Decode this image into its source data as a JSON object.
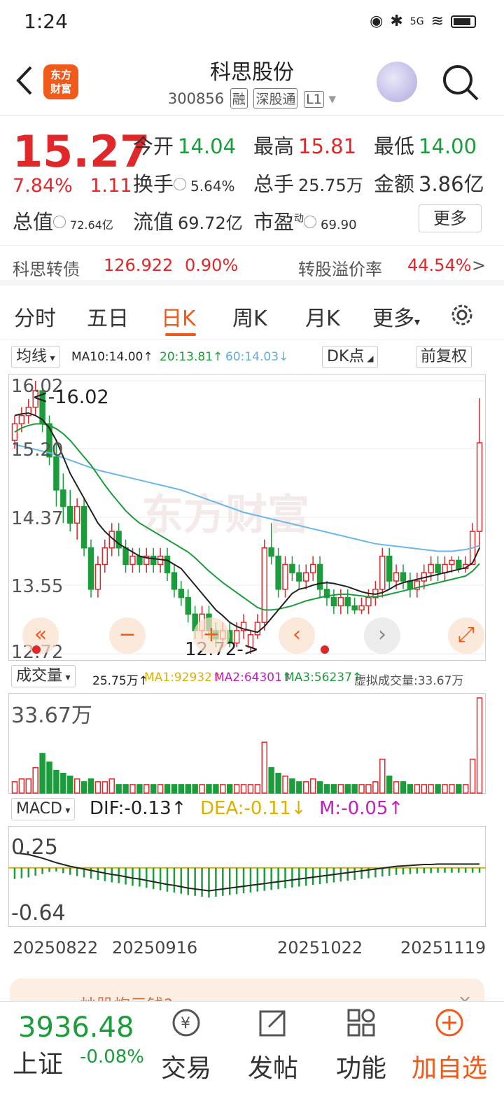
{
  "status": {
    "time": "1:24",
    "network": "5G"
  },
  "header": {
    "logo_text": "东方财富",
    "title": "科思股份",
    "code": "300856",
    "tags": [
      "融",
      "深股通",
      "L1"
    ]
  },
  "quote": {
    "price": "15.27",
    "change_pct": "7.84%",
    "change": "1.11",
    "open_label": "今开",
    "open": "14.04",
    "high_label": "最高",
    "high": "15.81",
    "low_label": "最低",
    "low": "14.00",
    "turnover_label": "换手",
    "turnover": "5.64%",
    "volume_label": "总手",
    "volume": "25.75万",
    "amount_label": "金额",
    "amount": "3.86亿",
    "mktcap_label": "总值",
    "mktcap": "72.64亿",
    "float_label": "流值",
    "float": "69.72亿",
    "pe_label": "市盈",
    "pe_sup": "动",
    "pe": "69.90",
    "more": "更多"
  },
  "bond": {
    "name": "科思转债",
    "price": "126.922",
    "pct": "0.90%",
    "premium_label": "转股溢价率",
    "premium": "44.54%"
  },
  "tabs": [
    "分时",
    "五日",
    "日K",
    "周K",
    "月K",
    "更多"
  ],
  "active_tab": "日K",
  "ma_bar": {
    "selector": "均线",
    "ma10": "MA10:14.00↑",
    "ma20": "20:13.81↑",
    "ma60": "60:14.03↓",
    "dk": "DK点",
    "adjust": "前复权"
  },
  "kline_labels": {
    "y_ticks": [
      "16.02",
      "15.20",
      "14.37",
      "13.55",
      "12.72"
    ],
    "max_label": "<-16.02",
    "min_label": "12.72->",
    "watermark": "东方财富"
  },
  "vol_bar": {
    "selector": "成交量",
    "vol": "25.75万↑",
    "ma1": "MA1:92932↑",
    "ma2": "MA2:64301↑",
    "ma3": "MA3:56237↑",
    "virtual": "虚拟成交量:33.67万",
    "y_max": "33.67万"
  },
  "macd_bar": {
    "selector": "MACD",
    "dif": "DIF:-0.13↑",
    "dea": "DEA:-0.11↓",
    "m": "M:-0.05↑",
    "y_top": "0.25",
    "y_bottom": "-0.64"
  },
  "dates": [
    "20250822",
    "20250916",
    "20251022",
    "20251119"
  ],
  "banner": {
    "text": "炒股炮元钱?"
  },
  "bottom": {
    "index_value": "3936.48",
    "index_name": "上证",
    "index_change": "-0.08%",
    "buttons": [
      "交易",
      "发帖",
      "功能",
      "加自选"
    ]
  },
  "colors": {
    "up": "#e0282a",
    "down": "#1a9d3a",
    "accent": "#f05a1a",
    "ma10": "#222222",
    "ma20": "#1a9d3a",
    "ma60": "#6ab7e8"
  },
  "chart_data": {
    "type": "candlestick",
    "ylim": [
      12.72,
      16.02
    ],
    "candles": [
      [
        15.3,
        15.6,
        15.2,
        15.5
      ],
      [
        15.5,
        15.7,
        15.4,
        15.6
      ],
      [
        15.6,
        15.8,
        15.5,
        15.7
      ],
      [
        15.7,
        16.02,
        15.6,
        15.9
      ],
      [
        15.9,
        16.0,
        15.4,
        15.5
      ],
      [
        15.5,
        15.6,
        15.0,
        15.1
      ],
      [
        15.1,
        15.3,
        14.5,
        14.7
      ],
      [
        14.7,
        14.9,
        14.3,
        14.5
      ],
      [
        14.5,
        14.7,
        14.2,
        14.3
      ],
      [
        14.3,
        14.6,
        14.1,
        14.5
      ],
      [
        14.5,
        14.6,
        13.9,
        14.0
      ],
      [
        14.0,
        14.1,
        13.4,
        13.5
      ],
      [
        13.5,
        13.9,
        13.4,
        13.8
      ],
      [
        13.8,
        14.1,
        13.7,
        14.0
      ],
      [
        14.0,
        14.3,
        13.9,
        14.2
      ],
      [
        14.2,
        14.3,
        13.9,
        14.0
      ],
      [
        14.0,
        14.1,
        13.7,
        13.8
      ],
      [
        13.8,
        14.0,
        13.7,
        13.9
      ],
      [
        13.9,
        14.0,
        13.7,
        13.8
      ],
      [
        13.8,
        14.0,
        13.7,
        13.9
      ],
      [
        13.9,
        14.0,
        13.7,
        13.8
      ],
      [
        13.8,
        14.0,
        13.7,
        13.9
      ],
      [
        13.9,
        14.0,
        13.6,
        13.7
      ],
      [
        13.7,
        13.8,
        13.4,
        13.5
      ],
      [
        13.5,
        13.6,
        13.3,
        13.4
      ],
      [
        13.4,
        13.5,
        13.1,
        13.2
      ],
      [
        13.2,
        13.3,
        12.9,
        13.0
      ],
      [
        13.0,
        13.3,
        12.9,
        13.2
      ],
      [
        13.2,
        13.3,
        12.9,
        13.0
      ],
      [
        13.0,
        13.1,
        12.8,
        12.9
      ],
      [
        12.9,
        13.1,
        12.8,
        13.0
      ],
      [
        13.0,
        13.1,
        12.8,
        12.85
      ],
      [
        12.85,
        13.1,
        12.8,
        13.0
      ],
      [
        13.0,
        13.2,
        12.9,
        13.1
      ],
      [
        12.8,
        13.0,
        12.72,
        12.95
      ],
      [
        12.95,
        13.2,
        12.9,
        13.1
      ],
      [
        13.1,
        14.1,
        13.0,
        14.0
      ],
      [
        14.0,
        14.3,
        13.8,
        13.9
      ],
      [
        13.9,
        14.0,
        13.4,
        13.5
      ],
      [
        13.5,
        13.9,
        13.4,
        13.8
      ],
      [
        13.8,
        13.9,
        13.6,
        13.7
      ],
      [
        13.7,
        13.8,
        13.5,
        13.6
      ],
      [
        13.6,
        13.8,
        13.5,
        13.7
      ],
      [
        13.7,
        13.9,
        13.6,
        13.8
      ],
      [
        13.8,
        13.9,
        13.4,
        13.5
      ],
      [
        13.5,
        13.6,
        13.3,
        13.4
      ],
      [
        13.4,
        13.5,
        13.2,
        13.3
      ],
      [
        13.3,
        13.5,
        13.2,
        13.4
      ],
      [
        13.4,
        13.5,
        13.2,
        13.3
      ],
      [
        13.3,
        13.4,
        13.2,
        13.25
      ],
      [
        13.25,
        13.4,
        13.2,
        13.3
      ],
      [
        13.3,
        13.5,
        13.2,
        13.4
      ],
      [
        13.4,
        13.6,
        13.3,
        13.5
      ],
      [
        13.5,
        14.0,
        13.4,
        13.9
      ],
      [
        13.9,
        14.0,
        13.5,
        13.6
      ],
      [
        13.6,
        13.8,
        13.5,
        13.7
      ],
      [
        13.7,
        13.8,
        13.5,
        13.6
      ],
      [
        13.6,
        13.7,
        13.4,
        13.5
      ],
      [
        13.5,
        13.7,
        13.4,
        13.6
      ],
      [
        13.6,
        13.8,
        13.5,
        13.7
      ],
      [
        13.7,
        13.9,
        13.6,
        13.8
      ],
      [
        13.8,
        13.9,
        13.6,
        13.7
      ],
      [
        13.7,
        13.9,
        13.6,
        13.8
      ],
      [
        13.8,
        13.9,
        13.7,
        13.85
      ],
      [
        13.85,
        13.9,
        13.7,
        13.75
      ],
      [
        13.75,
        13.9,
        13.7,
        13.8
      ],
      [
        13.8,
        14.3,
        13.8,
        14.2
      ],
      [
        14.2,
        15.81,
        14.0,
        15.27
      ]
    ],
    "ma10": [
      15.6,
      15.62,
      15.63,
      15.6,
      15.55,
      15.45,
      15.3,
      15.1,
      14.9,
      14.75,
      14.6,
      14.45,
      14.3,
      14.2,
      14.12,
      14.05,
      14.0,
      13.95,
      13.9,
      13.88,
      13.87,
      13.86,
      13.85,
      13.8,
      13.75,
      13.65,
      13.55,
      13.45,
      13.35,
      13.25,
      13.18,
      13.1,
      13.05,
      13.02,
      13.0,
      12.98,
      13.05,
      13.15,
      13.25,
      13.35,
      13.45,
      13.5,
      13.52,
      13.55,
      13.57,
      13.58,
      13.57,
      13.55,
      13.53,
      13.5,
      13.47,
      13.45,
      13.44,
      13.46,
      13.5,
      13.55,
      13.58,
      13.6,
      13.62,
      13.64,
      13.66,
      13.68,
      13.7,
      13.72,
      13.74,
      13.76,
      13.82,
      14.0
    ],
    "ma20": [
      15.4,
      15.45,
      15.48,
      15.5,
      15.5,
      15.48,
      15.44,
      15.38,
      15.3,
      15.2,
      15.1,
      15.0,
      14.88,
      14.76,
      14.65,
      14.55,
      14.45,
      14.37,
      14.3,
      14.25,
      14.2,
      14.15,
      14.1,
      14.05,
      14.0,
      13.95,
      13.88,
      13.8,
      13.72,
      13.65,
      13.58,
      13.52,
      13.46,
      13.4,
      13.34,
      13.28,
      13.25,
      13.25,
      13.26,
      13.28,
      13.3,
      13.33,
      13.36,
      13.38,
      13.4,
      13.42,
      13.43,
      13.44,
      13.44,
      13.43,
      13.42,
      13.41,
      13.41,
      13.42,
      13.44,
      13.46,
      13.48,
      13.5,
      13.52,
      13.54,
      13.56,
      13.58,
      13.6,
      13.62,
      13.64,
      13.66,
      13.72,
      13.81
    ],
    "ma60": [
      15.25,
      15.23,
      15.21,
      15.19,
      15.17,
      15.15,
      15.12,
      15.09,
      15.06,
      15.03,
      15.0,
      14.97,
      14.94,
      14.92,
      14.9,
      14.88,
      14.86,
      14.84,
      14.82,
      14.8,
      14.78,
      14.76,
      14.74,
      14.72,
      14.7,
      14.67,
      14.64,
      14.61,
      14.58,
      14.55,
      14.52,
      14.49,
      14.46,
      14.43,
      14.41,
      14.39,
      14.37,
      14.35,
      14.33,
      14.31,
      14.29,
      14.27,
      14.25,
      14.23,
      14.21,
      14.19,
      14.17,
      14.15,
      14.13,
      14.11,
      14.09,
      14.07,
      14.05,
      14.04,
      14.03,
      14.02,
      14.01,
      14.0,
      13.99,
      13.98,
      13.97,
      13.96,
      13.96,
      13.96,
      13.97,
      13.98,
      14.0,
      14.03
    ],
    "volume": [
      4,
      5,
      5,
      9,
      14,
      11,
      8,
      7,
      6,
      5,
      4,
      5,
      4,
      4,
      5,
      3,
      3,
      3,
      3,
      3,
      3,
      3,
      3,
      3,
      3,
      3,
      3,
      3,
      3,
      3,
      3,
      3,
      3,
      3,
      3,
      3,
      18,
      9,
      7,
      6,
      5,
      4,
      4,
      5,
      4,
      3,
      3,
      3,
      3,
      3,
      3,
      3,
      4,
      12,
      6,
      4,
      4,
      3,
      3,
      3,
      3,
      3,
      3,
      3,
      3,
      3,
      12,
      33.67
    ],
    "macd": [
      0.2,
      0.18,
      0.16,
      0.12,
      0.08,
      0.03,
      -0.02,
      -0.06,
      -0.1,
      -0.13,
      -0.16,
      -0.19,
      -0.22,
      -0.25,
      -0.28,
      -0.3,
      -0.33,
      -0.36,
      -0.38,
      -0.41,
      -0.44,
      -0.47,
      -0.5,
      -0.52,
      -0.55,
      -0.58,
      -0.6,
      -0.62,
      -0.64,
      -0.62,
      -0.6,
      -0.58,
      -0.56,
      -0.54,
      -0.52,
      -0.5,
      -0.48,
      -0.46,
      -0.44,
      -0.42,
      -0.4,
      -0.38,
      -0.36,
      -0.34,
      -0.32,
      -0.3,
      -0.28,
      -0.26,
      -0.24,
      -0.22,
      -0.2,
      -0.18,
      -0.16,
      -0.14,
      -0.12,
      -0.1,
      -0.09,
      -0.08,
      -0.07,
      -0.06,
      -0.06,
      -0.05,
      -0.05,
      -0.05,
      -0.05,
      -0.05,
      -0.05,
      -0.05
    ]
  }
}
